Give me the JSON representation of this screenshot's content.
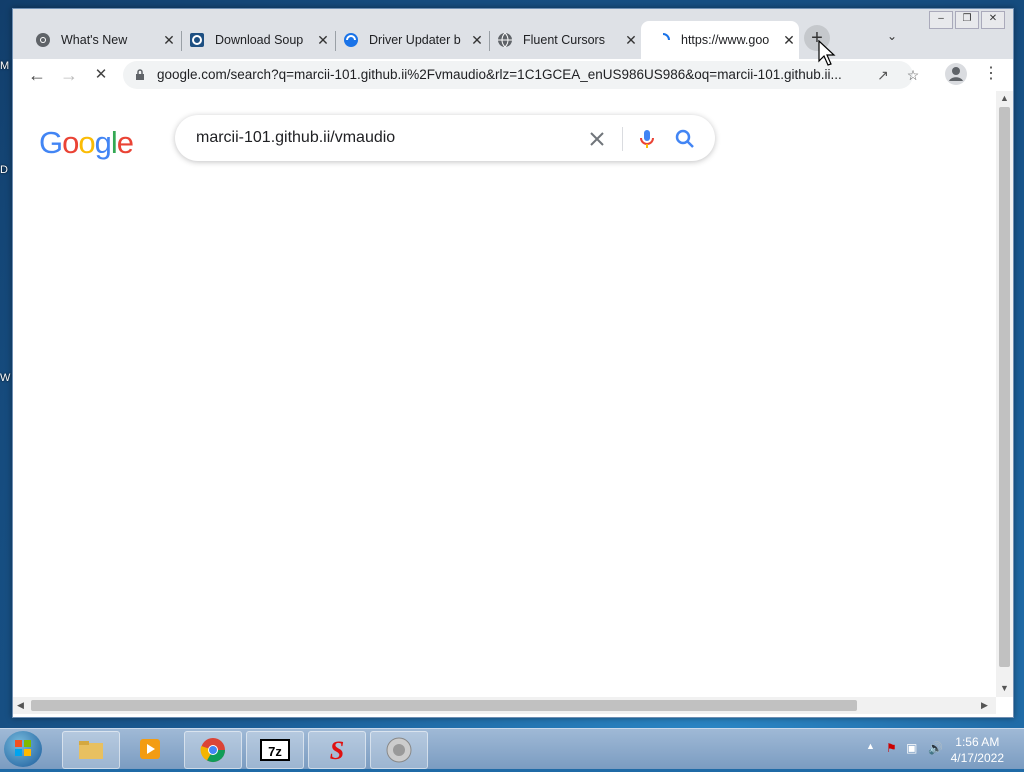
{
  "desktop": {
    "letters": [
      "M",
      "D",
      "W"
    ]
  },
  "tabs": [
    {
      "title": "What's New",
      "icon": "chrome-icon"
    },
    {
      "title": "Download Soup",
      "icon": "download-icon"
    },
    {
      "title": "Driver Updater b",
      "icon": "driver-updater-icon"
    },
    {
      "title": "Fluent Cursors",
      "icon": "globe-icon"
    },
    {
      "title": "https://www.goo",
      "icon": "loading-spinner-icon",
      "active": true
    }
  ],
  "toolbar": {
    "url": "google.com/search?q=marcii-101.github.ii%2Fvmaudio&rlz=1C1GCEA_enUS986US986&oq=marcii-101.github.ii..."
  },
  "google": {
    "logo_letters": [
      {
        "ch": "G",
        "color": "#4285F4"
      },
      {
        "ch": "o",
        "color": "#EA4335"
      },
      {
        "ch": "o",
        "color": "#FBBC05"
      },
      {
        "ch": "g",
        "color": "#4285F4"
      },
      {
        "ch": "l",
        "color": "#34A853"
      },
      {
        "ch": "e",
        "color": "#EA4335"
      }
    ],
    "search_query": "marcii-101.github.ii/vmaudio"
  },
  "taskbar": {
    "items": [
      "file-explorer-icon",
      "media-player-icon",
      "chrome-icon",
      "7zip-icon",
      "s-app-icon",
      "speaker-app-icon"
    ],
    "clock": {
      "time": "1:56 AM",
      "date": "4/17/2022"
    }
  }
}
